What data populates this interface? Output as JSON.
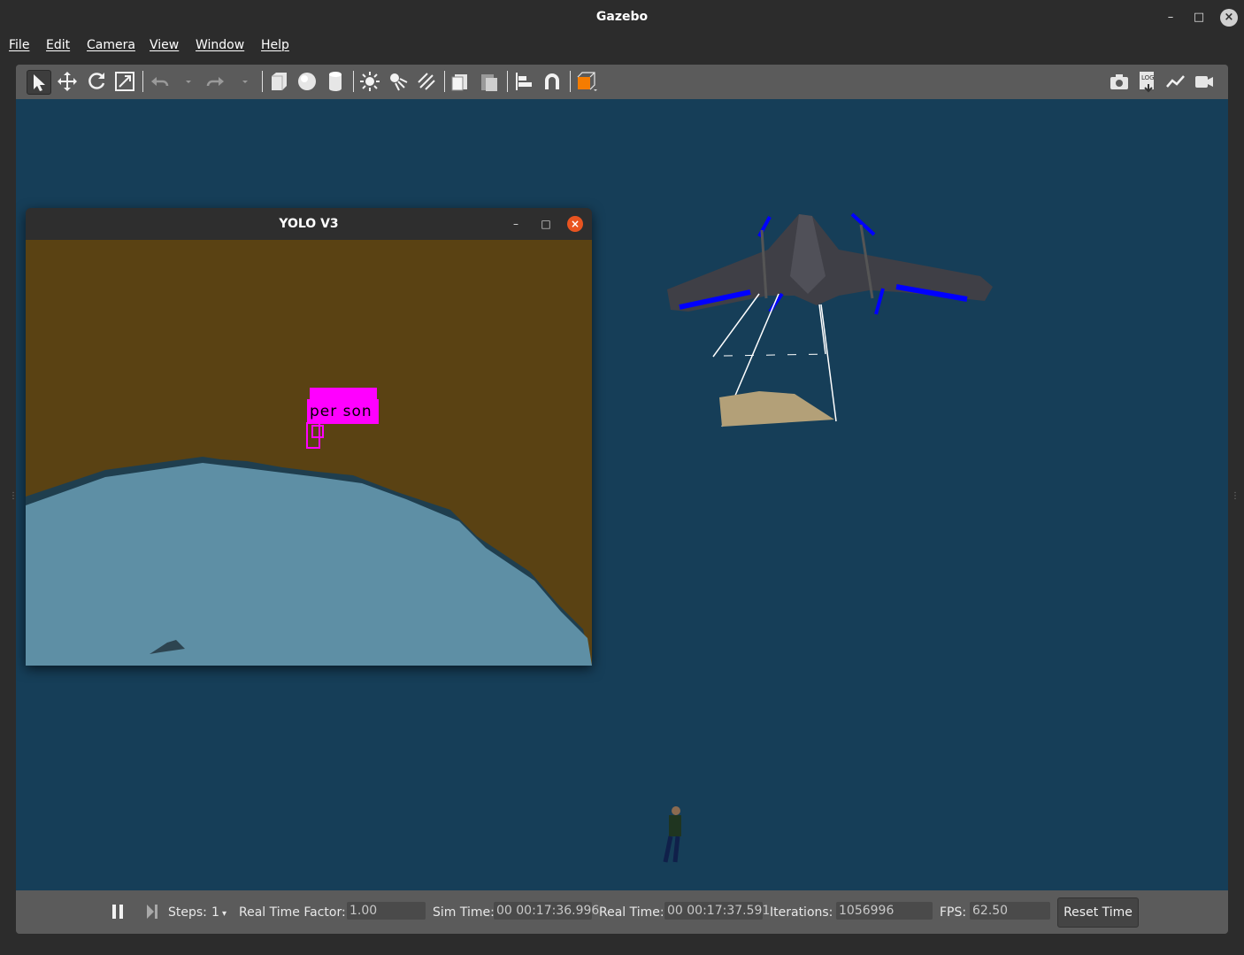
{
  "window": {
    "title": "Gazebo"
  },
  "menu": [
    "File",
    "Edit",
    "Camera",
    "View",
    "Window",
    "Help"
  ],
  "toolbar": {
    "left_icons": [
      "select-arrow-icon",
      "translate-icon",
      "rotate-icon",
      "scale-icon",
      "undo-icon",
      "undo-dropdown-icon",
      "redo-icon",
      "redo-dropdown-icon",
      "box-shape-icon",
      "sphere-shape-icon",
      "cylinder-shape-icon",
      "point-light-icon",
      "spot-light-icon",
      "directional-light-icon",
      "copy-icon",
      "paste-icon",
      "align-icon",
      "snap-magnet-icon",
      "view-angle-icon"
    ],
    "right_icons": [
      "screenshot-camera-icon",
      "log-icon",
      "plot-icon",
      "video-record-icon"
    ]
  },
  "yolo_window": {
    "title": "YOLO V3",
    "detection_label": "per son"
  },
  "statusbar": {
    "steps_label": "Steps:",
    "steps_value": "1",
    "rtf_label": "Real Time Factor:",
    "rtf_value": "1.00",
    "sim_time_label": "Sim Time:",
    "sim_time_value": "00 00:17:36.996",
    "real_time_label": "Real Time:",
    "real_time_value": "00 00:17:37.591",
    "iterations_label": "Iterations:",
    "iterations_value": "1056996",
    "fps_label": "FPS:",
    "fps_value": "62.50",
    "reset_label": "Reset Time"
  },
  "colors": {
    "viewport_bg": "#163e58",
    "yolo_ground": "#5a4213",
    "detection": "#ff00ff",
    "accent_orange": "#e95420",
    "propeller_blue": "#0000ff"
  }
}
